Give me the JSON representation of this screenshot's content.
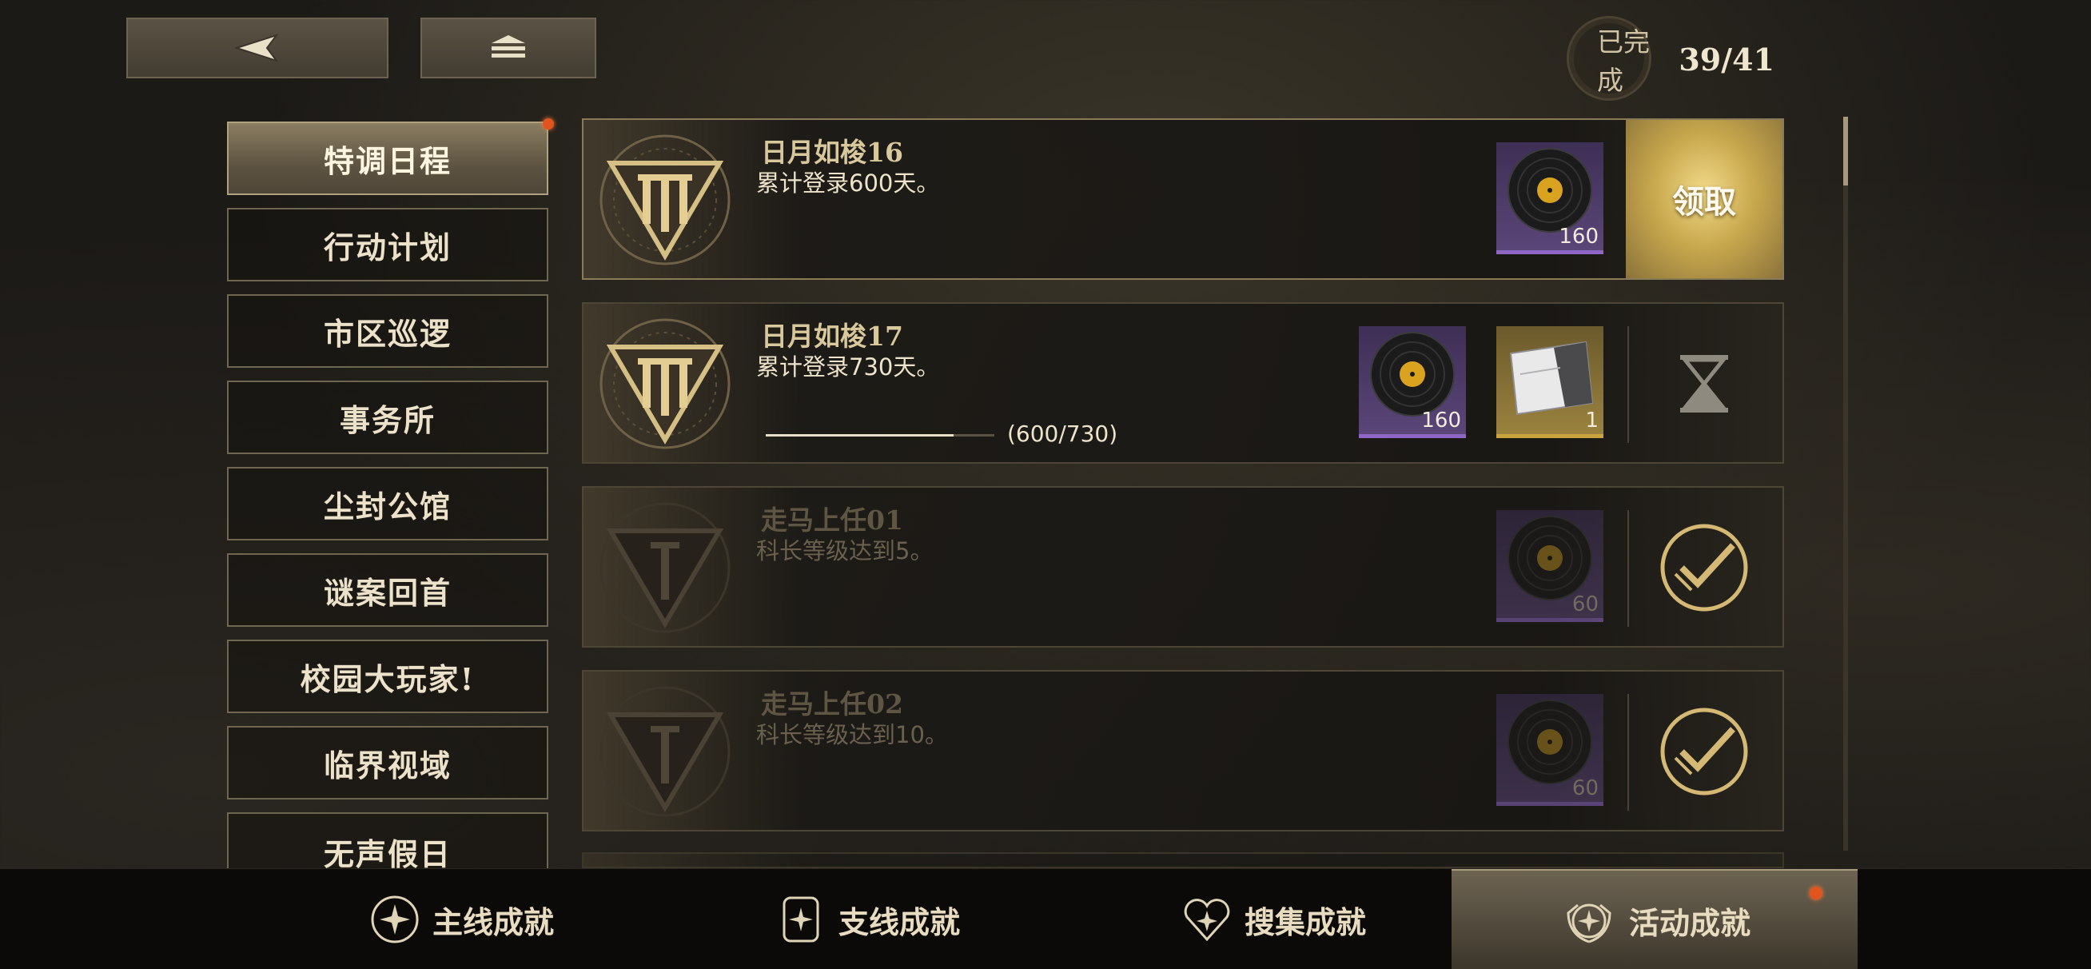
{
  "header": {
    "back_icon": "back-arrow-icon",
    "home_icon": "home-stack-icon",
    "completion_label": "已完成",
    "completion_count": "39/41"
  },
  "sidebar": {
    "items": [
      {
        "label": "特调日程",
        "active": true,
        "badge": true
      },
      {
        "label": "行动计划"
      },
      {
        "label": "市区巡逻"
      },
      {
        "label": "事务所"
      },
      {
        "label": "尘封公馆"
      },
      {
        "label": "谜案回首"
      },
      {
        "label": "校园大玩家!"
      },
      {
        "label": "临界视域"
      },
      {
        "label": "无声假日"
      }
    ]
  },
  "achievements": [
    {
      "title": "日月如梭16",
      "desc": "累计登录600天。",
      "emblem": "III",
      "state": "claimable",
      "action_label": "领取",
      "rewards": [
        {
          "icon": "vinyl-record-icon",
          "qty": "160"
        }
      ]
    },
    {
      "title": "日月如梭17",
      "desc": "累计登录730天。",
      "emblem": "III",
      "state": "in-progress",
      "progress_text": "(600/730)",
      "progress_value": 600,
      "progress_max": 730,
      "rewards": [
        {
          "icon": "vinyl-record-icon",
          "qty": "160"
        },
        {
          "icon": "ticket-card-icon",
          "qty": "1"
        }
      ]
    },
    {
      "title": "走马上任01",
      "desc": "科长等级达到5。",
      "emblem": "I",
      "state": "completed",
      "rewards": [
        {
          "icon": "vinyl-record-icon",
          "qty": "60"
        }
      ]
    },
    {
      "title": "走马上任02",
      "desc": "科长等级达到10。",
      "emblem": "I",
      "state": "completed",
      "rewards": [
        {
          "icon": "vinyl-record-icon",
          "qty": "60"
        }
      ]
    }
  ],
  "bottom_nav": {
    "tabs": [
      {
        "label": "主线成就",
        "icon": "main-achievement-icon"
      },
      {
        "label": "支线成就",
        "icon": "side-achievement-icon"
      },
      {
        "label": "搜集成就",
        "icon": "collection-achievement-icon"
      },
      {
        "label": "活动成就",
        "icon": "event-achievement-icon",
        "active": true,
        "badge": true
      }
    ]
  },
  "colors": {
    "accent_gold": "#c9a94e",
    "badge_red": "#e0541e",
    "purple_rarity": "#8e66c6"
  }
}
